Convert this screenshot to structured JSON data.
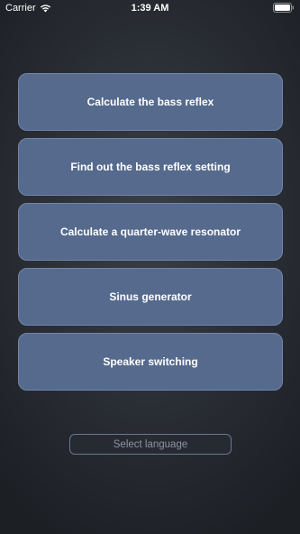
{
  "status_bar": {
    "carrier": "Carrier",
    "time": "1:39 AM",
    "icons": [
      "wifi-icon",
      "battery-icon"
    ]
  },
  "menu": {
    "items": [
      {
        "label": "Calculate the bass reflex"
      },
      {
        "label": "Find out the bass reflex setting"
      },
      {
        "label": "Calculate a quarter-wave resonator"
      },
      {
        "label": "Sinus generator"
      },
      {
        "label": "Speaker switching"
      }
    ]
  },
  "language": {
    "placeholder": "Select language"
  },
  "colors": {
    "button_bg": "#566a8e",
    "button_border": "#7285a8",
    "background": "#2c3037"
  }
}
